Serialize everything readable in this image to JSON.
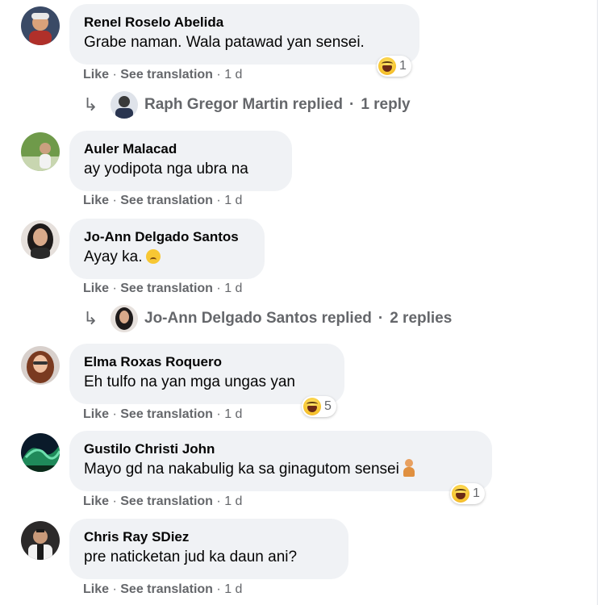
{
  "actions": {
    "like": "Like",
    "see_translation": "See translation",
    "sep": "·",
    "time": "1 d"
  },
  "comments": [
    {
      "author": "Renel Roselo Abelida",
      "text": "Grabe naman. Wala patawad yan sensei.",
      "reaction": {
        "icon": "haha-icon",
        "count": "1"
      },
      "reply": {
        "name": "Raph Gregor Martin replied",
        "sep": "·",
        "count": "1 reply"
      }
    },
    {
      "author": "Auler Malacad",
      "text": "ay yodipota nga ubra na"
    },
    {
      "author": "Jo-Ann Delgado Santos",
      "text": "Ayay ka.",
      "inline_emoji": "sad-face-icon",
      "reply": {
        "name": "Jo-Ann Delgado Santos replied",
        "sep": "·",
        "count": "2 replies"
      }
    },
    {
      "author": "Elma Roxas Roquero",
      "text": "Eh tulfo na yan mga ungas yan",
      "reaction": {
        "icon": "haha-icon",
        "count": "5"
      }
    },
    {
      "author": "Gustilo Christi John",
      "text": "Mayo gd na nakabulig ka sa ginagutom sensei",
      "inline_emoji": "person-icon",
      "reaction": {
        "icon": "haha-icon",
        "count": "1"
      }
    },
    {
      "author": "Chris Ray SDiez",
      "text": "pre naticketan jud ka daun ani?"
    }
  ],
  "colors": {
    "bubble": "#f0f2f5",
    "meta": "#65676b",
    "text": "#050505"
  }
}
